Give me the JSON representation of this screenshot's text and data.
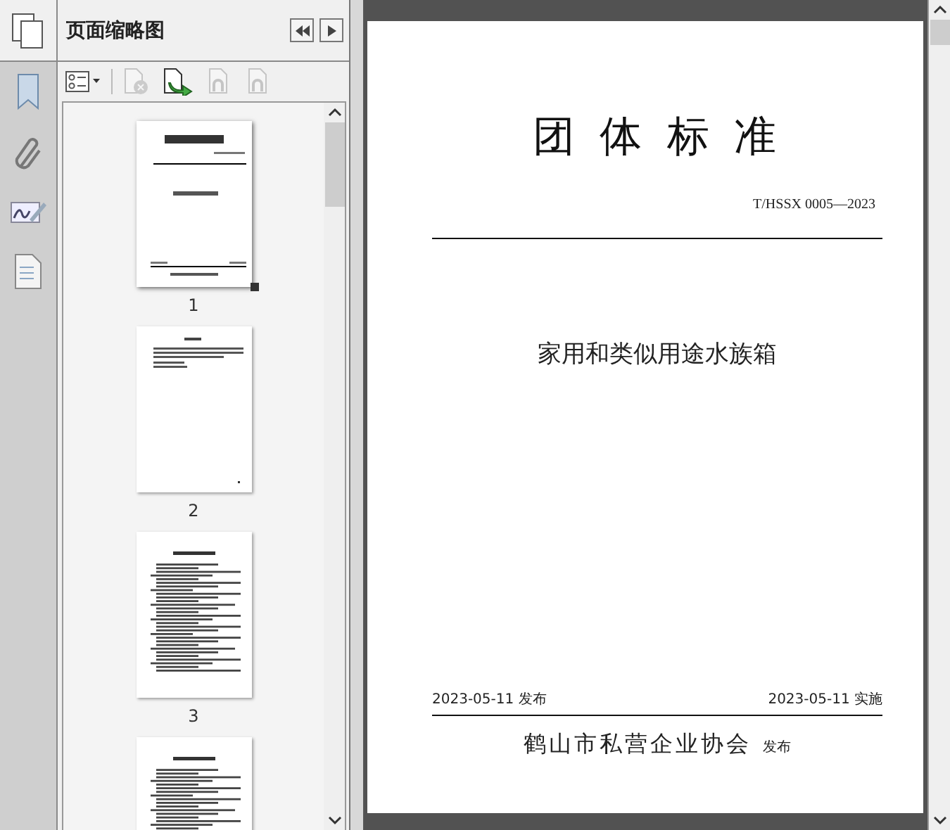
{
  "panel": {
    "title": "页面缩略图"
  },
  "toolbar": [
    {
      "kind": "options",
      "disabled": false
    },
    {
      "kind": "delete",
      "disabled": true
    },
    {
      "kind": "insert",
      "disabled": false
    },
    {
      "kind": "undo",
      "disabled": true
    },
    {
      "kind": "redo",
      "disabled": true
    }
  ],
  "thumbnails": [
    {
      "label": "1",
      "selected": true,
      "kind": "cover"
    },
    {
      "label": "2",
      "selected": false,
      "kind": "preface"
    },
    {
      "label": "3",
      "selected": false,
      "kind": "text"
    },
    {
      "kind": "text",
      "selected": false
    }
  ],
  "page": {
    "heading": "团 体 标 准",
    "code": "T/HSSX 0005—2023",
    "title": "家用和类似用途水族箱",
    "published": "2023-05-11 发布",
    "effective": "2023-05-11 实施",
    "issuer": "鹤山市私营企业协会",
    "issuer_suffix": "发布"
  }
}
